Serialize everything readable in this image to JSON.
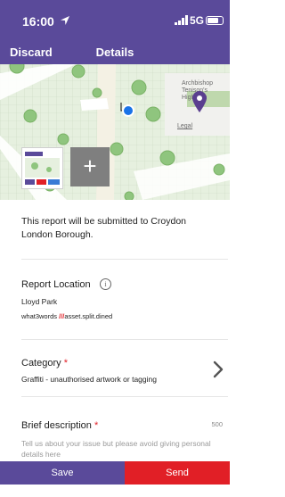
{
  "status_bar": {
    "time": "16:00",
    "network": "5G"
  },
  "nav": {
    "discard_label": "Discard",
    "title": "Details"
  },
  "map": {
    "labels": [
      "Archbishop",
      "Tenison's",
      "High Sch"
    ],
    "legal_label": "Legal"
  },
  "add_photo_label": "+",
  "submission_text": "This report will be submitted to Croydon London Borough.",
  "report_location": {
    "title": "Report Location",
    "info_icon": "i",
    "place": "Lloyd Park",
    "w3w_prefix": "what3words ",
    "w3w_slashes": "///",
    "w3w_words": "asset.split.dined"
  },
  "category": {
    "title": "Category",
    "required_mark": "*",
    "value": "Graffiti - unauthorised artwork or tagging"
  },
  "description": {
    "title": "Brief description",
    "required_mark": "*",
    "counter": "500",
    "placeholder": "Tell us about your issue but please avoid giving personal details here"
  },
  "actions": {
    "save_label": "Save",
    "send_label": "Send"
  },
  "colors": {
    "brand_purple": "#5a4a9a",
    "send_red": "#e11f26",
    "map_pin": "#5a3f8f",
    "location_dot": "#1a73e8"
  },
  "icons": [
    "location-arrow-icon",
    "signal-icon",
    "battery-icon",
    "info-icon",
    "chevron-right-icon",
    "map-pin-icon",
    "current-location-icon",
    "add-icon"
  ]
}
